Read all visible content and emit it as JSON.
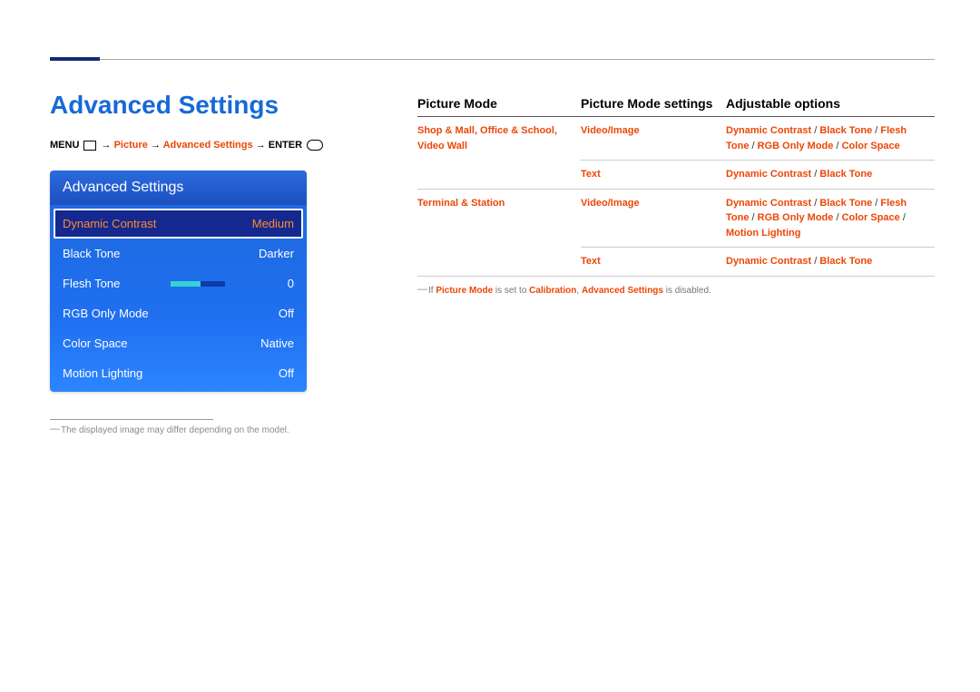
{
  "page": {
    "title": "Advanced Settings",
    "breadcrumb": {
      "menu": "MENU",
      "arrow": " → ",
      "picture": "Picture",
      "advanced": "Advanced Settings",
      "enter": "ENTER"
    },
    "footnote": "The displayed image may differ depending on the model."
  },
  "panel": {
    "title": "Advanced Settings",
    "rows": [
      {
        "label": "Dynamic Contrast",
        "value": "Medium",
        "selected": true
      },
      {
        "label": "Black Tone",
        "value": "Darker"
      },
      {
        "label": "Flesh Tone",
        "value": "0",
        "slider": true
      },
      {
        "label": "RGB Only Mode",
        "value": "Off"
      },
      {
        "label": "Color Space",
        "value": "Native"
      },
      {
        "label": "Motion Lighting",
        "value": "Off"
      }
    ]
  },
  "table": {
    "headers": {
      "mode": "Picture Mode",
      "settings": "Picture Mode settings",
      "options": "Adjustable options"
    },
    "rows": [
      {
        "mode": "Shop & Mall, Office & School, Video Wall",
        "settings": "Video/Image",
        "options_html": "<b>Dynamic Contrast</b> <span class='sep'>/</span> <b>Black Tone</b> <span class='sep'>/</span> <b>Flesh Tone</b> <span class='sep'>/</span> <b>RGB Only Mode</b> <span class='sep'>/</span> <b>Color Space</b>"
      },
      {
        "mode": "",
        "settings": "Text",
        "options_html": "<b>Dynamic Contrast</b> <span class='sep'>/</span> <b>Black Tone</b>"
      },
      {
        "mode": "Terminal & Station",
        "settings": "Video/Image",
        "options_html": "<b>Dynamic Contrast</b> <span class='sep'>/</span> <b>Black Tone</b> <span class='sep'>/</span> <b>Flesh Tone</b> <span class='sep'>/</span> <b>RGB Only Mode</b> <span class='sep'>/</span> <b>Color Space</b> <span class='sep'>/</span> <b>Motion Lighting</b>"
      },
      {
        "mode": "",
        "settings": "Text",
        "options_html": "<b>Dynamic Contrast</b> <span class='sep'>/</span> <b>Black Tone</b>"
      }
    ],
    "note": {
      "pre": "If ",
      "pm": "Picture Mode",
      "mid": " is set to ",
      "cal": "Calibration",
      "mid2": ", ",
      "adv": "Advanced Settings",
      "post": " is disabled."
    }
  }
}
